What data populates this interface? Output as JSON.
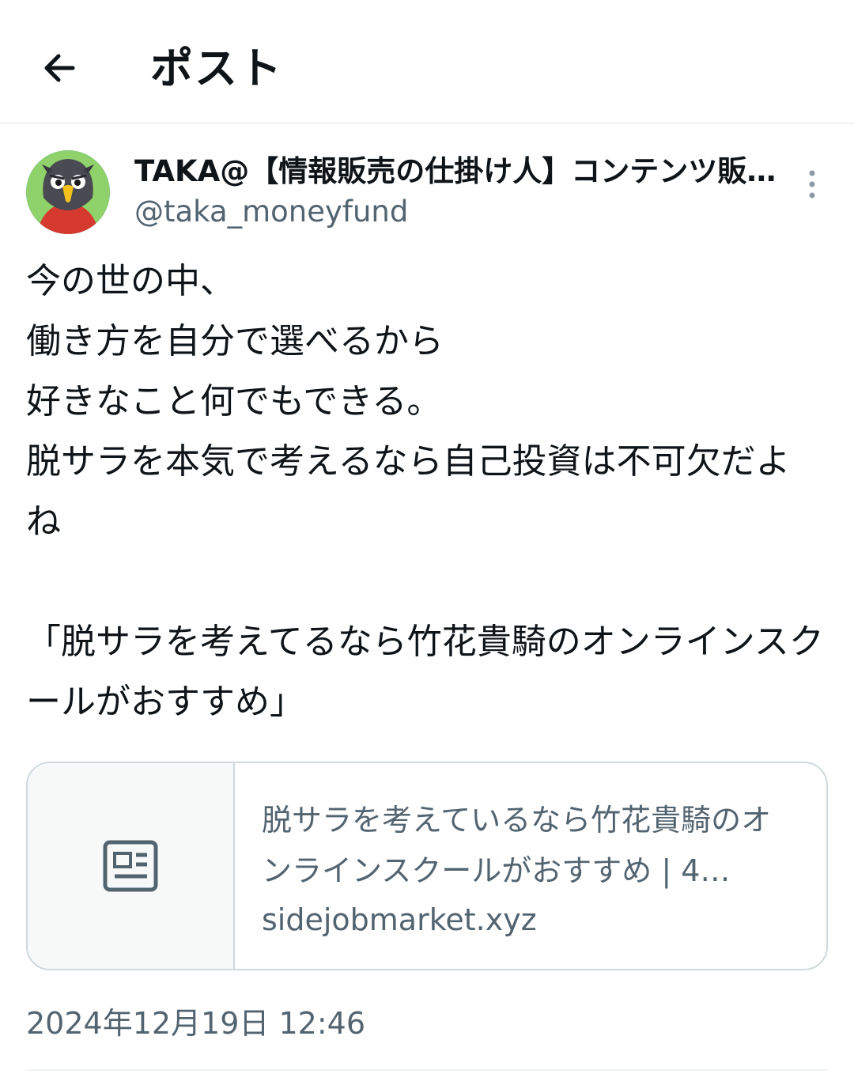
{
  "header": {
    "title": "ポスト"
  },
  "author": {
    "display_name": "TAKA@【情報販売の仕掛け人】コンテンツ販売・Brain・Tips・有料note・ココナラ",
    "handle": "@taka_moneyfund"
  },
  "post": {
    "text": "今の世の中、\n働き方を自分で選べるから\n好きなこと何でもできる。\n脱サラを本気で考えるなら自己投資は不可欠だよね\n\n「脱サラを考えてるなら竹花貴騎のオンラインスクールがおすすめ」",
    "timestamp": "2024年12月19日 12:46"
  },
  "link_card": {
    "title": "脱サラを考えているなら竹花貴騎のオンラインスクールがおすすめ | 4…",
    "domain": "sidejobmarket.xyz"
  },
  "icons": {
    "back": "arrow-left-icon",
    "more": "vertical-dots-icon",
    "card": "article-icon"
  },
  "colors": {
    "text_primary": "#0f1419",
    "text_secondary": "#536471",
    "border": "#cfd9de"
  }
}
